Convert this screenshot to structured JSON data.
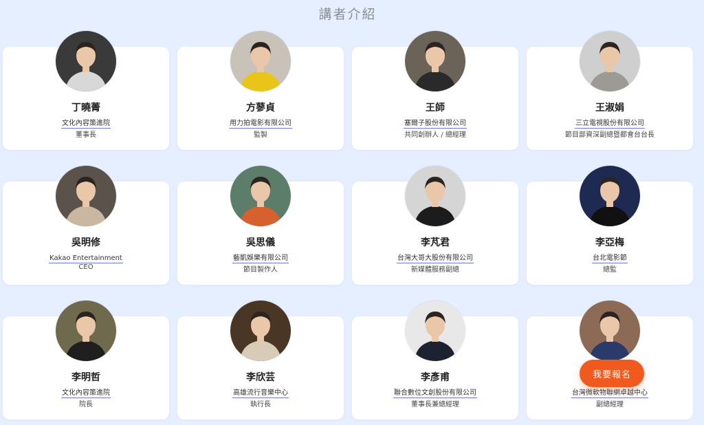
{
  "section_title": "講者介紹",
  "cta_label": "我要報名",
  "speakers": [
    {
      "name": "丁曉菁",
      "org": "文化內容策進院",
      "role": "董事長",
      "bg": "#3a3a3a",
      "shirt": "#d8d8d8"
    },
    {
      "name": "方蓼貞",
      "org": "用力拍電影有限公司",
      "role": "監製",
      "bg": "#c8c2b8",
      "shirt": "#e8c518"
    },
    {
      "name": "王師",
      "org": "塞爾子股份有限公司",
      "role": "共同創辦人 / 總經理",
      "bg": "#6b6258",
      "shirt": "#2a2a2a"
    },
    {
      "name": "王淑娟",
      "org": "三立電視股份有限公司",
      "role": "節目部資深副總暨都會台台長",
      "bg": "#cfcfcf",
      "shirt": "#9c9a94"
    },
    {
      "name": "吳明修",
      "org": "Kakao Entertainment",
      "role": "CEO",
      "bg": "#5b524c",
      "shirt": "#c9b7a1"
    },
    {
      "name": "吳思儀",
      "org": "藝凱娛樂有限公司",
      "role": "節目製作人",
      "bg": "#5b7d6a",
      "shirt": "#d6602e"
    },
    {
      "name": "李芃君",
      "org": "台灣大哥大股份有限公司",
      "role": "新媒體服務副總",
      "bg": "#d5d5d5",
      "shirt": "#1c1c1c"
    },
    {
      "name": "李亞梅",
      "org": "台北電影節",
      "role": "總監",
      "bg": "#1e2a52",
      "shirt": "#111111"
    },
    {
      "name": "李明哲",
      "org": "文化內容策進院",
      "role": "院長",
      "bg": "#6f6a4e",
      "shirt": "#1f1f1f"
    },
    {
      "name": "李欣芸",
      "org": "高雄流行音樂中心",
      "role": "執行長",
      "bg": "#4a3625",
      "shirt": "#d8cbb8"
    },
    {
      "name": "李彥甫",
      "org": "聯合數位文創股份有限公司",
      "role": "董事長兼總經理",
      "bg": "#e8e8e8",
      "shirt": "#1d2230"
    },
    {
      "name": "",
      "org": "台灣微軟物聯網卓越中心",
      "role": "副總經理",
      "bg": "#8c6a55",
      "shirt": "#2a3a6a"
    }
  ]
}
